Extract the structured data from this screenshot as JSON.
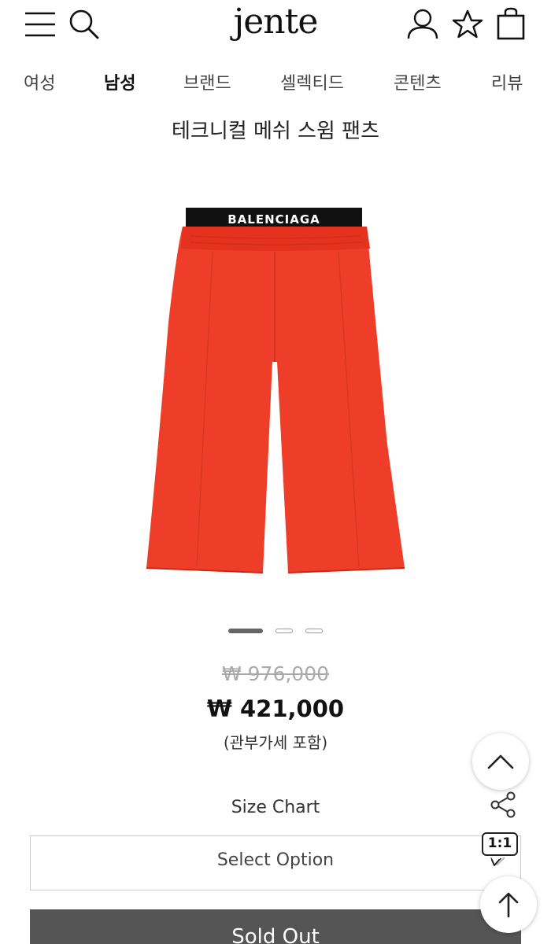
{
  "header": {
    "logo": "jente",
    "icons": [
      "menu-icon",
      "search-icon",
      "user-icon",
      "star-icon",
      "shopping-bag-icon"
    ]
  },
  "nav": {
    "items": [
      {
        "label": "여성",
        "active": false
      },
      {
        "label": "남성",
        "active": true
      },
      {
        "label": "브랜드",
        "active": false
      },
      {
        "label": "셀렉티드",
        "active": false
      },
      {
        "label": "콘텐츠",
        "active": false
      },
      {
        "label": "리뷰",
        "active": false
      }
    ]
  },
  "product": {
    "title": "테크니컬 메쉬 스윔 팬츠",
    "image": {
      "brand_text": "BALENCIAGA",
      "color": "#ee3e2a"
    },
    "carousel": {
      "total": 3,
      "current": 1
    },
    "price_original": "₩ 976,000",
    "price_sale": "₩ 421,000",
    "price_note": "(관부가세 포함)"
  },
  "options": {
    "size_chart_label": "Size Chart",
    "select_placeholder": "Select Option"
  },
  "purchase": {
    "button_label": "Sold Out"
  },
  "floating": {
    "chat_badge": "1:1",
    "icons": [
      "scroll-up-chevron-icon",
      "share-icon",
      "chat-icon",
      "back-to-top-arrow-icon"
    ]
  }
}
